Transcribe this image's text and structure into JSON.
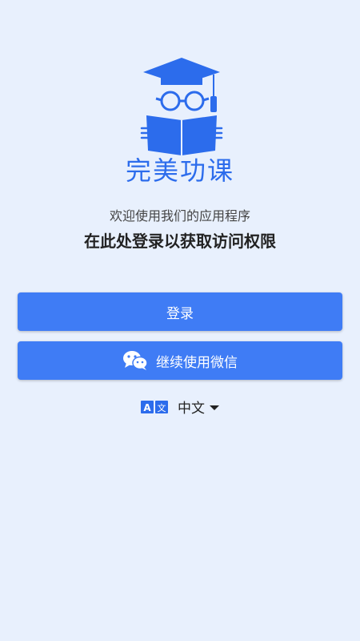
{
  "app": {
    "name": "完美功课",
    "brand_color": "#2c6cec",
    "logo_icon": "scholar-reading-book-icon"
  },
  "intro": {
    "welcome": "欢迎使用我们的应用程序",
    "headline": "在此处登录以获取访问权限"
  },
  "buttons": {
    "login_label": "登录",
    "wechat_label": "继续使用微信",
    "wechat_icon": "wechat-icon",
    "color": "#3f7cf5"
  },
  "language": {
    "icon": "translate-icon",
    "selected": "中文"
  }
}
